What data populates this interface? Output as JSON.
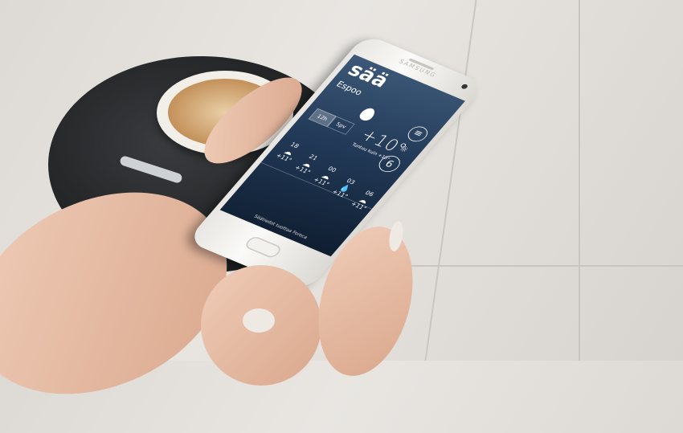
{
  "app": {
    "logo": "sää",
    "city": "Espoo",
    "menu_icon": "≡",
    "tabs": [
      "12h",
      "5pv"
    ],
    "temperature": "+10°",
    "feels_like": "Tuntuu kuin +10°",
    "wind_speed": "6",
    "sun_icon": "☼",
    "forecast": [
      {
        "hour": "18",
        "icon": "☁",
        "temp": "+11°"
      },
      {
        "hour": "21",
        "icon": "☁",
        "temp": "+11°"
      },
      {
        "hour": "00",
        "icon": "☁",
        "temp": "+11°"
      },
      {
        "hour": "03",
        "icon": "💧",
        "temp": "+11°"
      },
      {
        "hour": "06",
        "icon": "☁",
        "temp": "+11°"
      }
    ],
    "footer": "Säätiedot tuottaa Foreca"
  },
  "device": {
    "brand": "SAMSUNG"
  }
}
